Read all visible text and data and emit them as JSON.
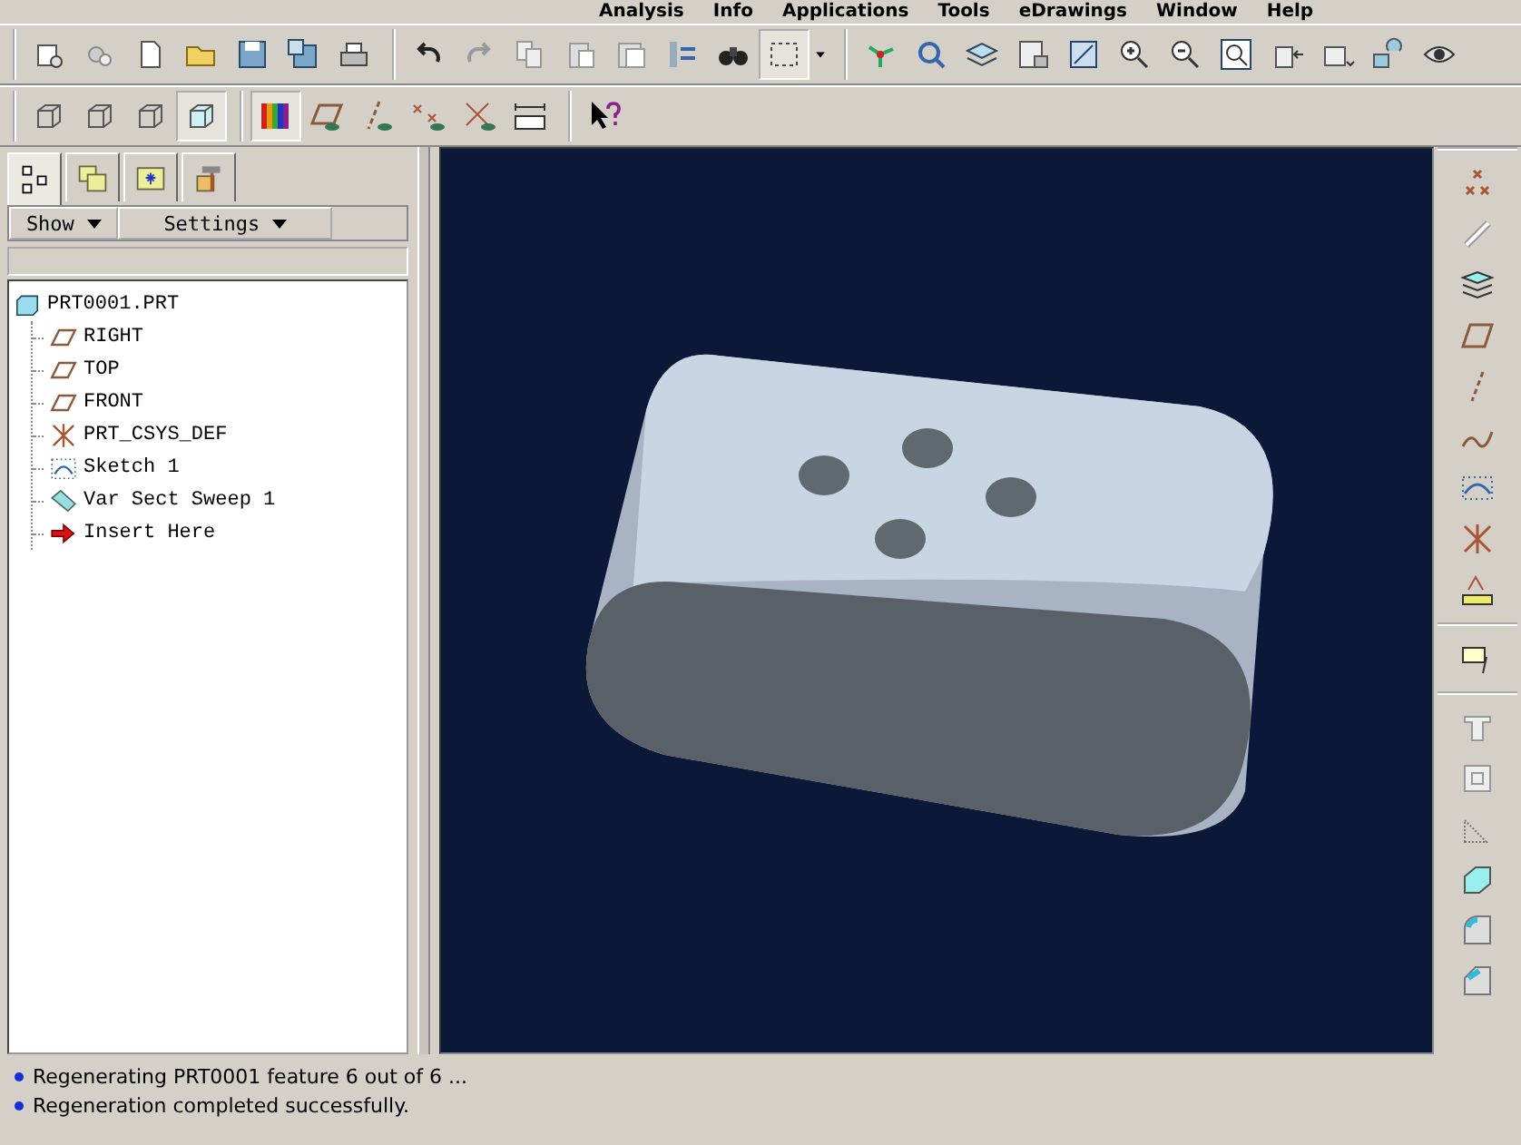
{
  "menu_bar": [
    "Analysis",
    "Info",
    "Applications",
    "Tools",
    "eDrawings",
    "Window",
    "Help"
  ],
  "navigator": {
    "tabs": [
      {
        "kind": "tree",
        "selected": true
      },
      {
        "kind": "layers",
        "selected": false
      },
      {
        "kind": "favorites",
        "selected": false
      },
      {
        "kind": "tools",
        "selected": false
      }
    ],
    "buttons": [
      "Show",
      "Settings"
    ],
    "tree": [
      {
        "label": "PRT0001.PRT",
        "kind": "part",
        "children": [
          {
            "label": "RIGHT",
            "kind": "plane"
          },
          {
            "label": "TOP",
            "kind": "plane"
          },
          {
            "label": "FRONT",
            "kind": "plane"
          },
          {
            "label": "PRT_CSYS_DEF",
            "kind": "csys"
          },
          {
            "label": "Sketch 1",
            "kind": "sketch"
          },
          {
            "label": "Var Sect Sweep 1",
            "kind": "sweep"
          },
          {
            "label": "Insert Here",
            "kind": "insert"
          }
        ]
      }
    ]
  },
  "status_messages": [
    "Regenerating PRT0001 feature 6 out of 6 ...",
    "Regeneration completed successfully."
  ]
}
